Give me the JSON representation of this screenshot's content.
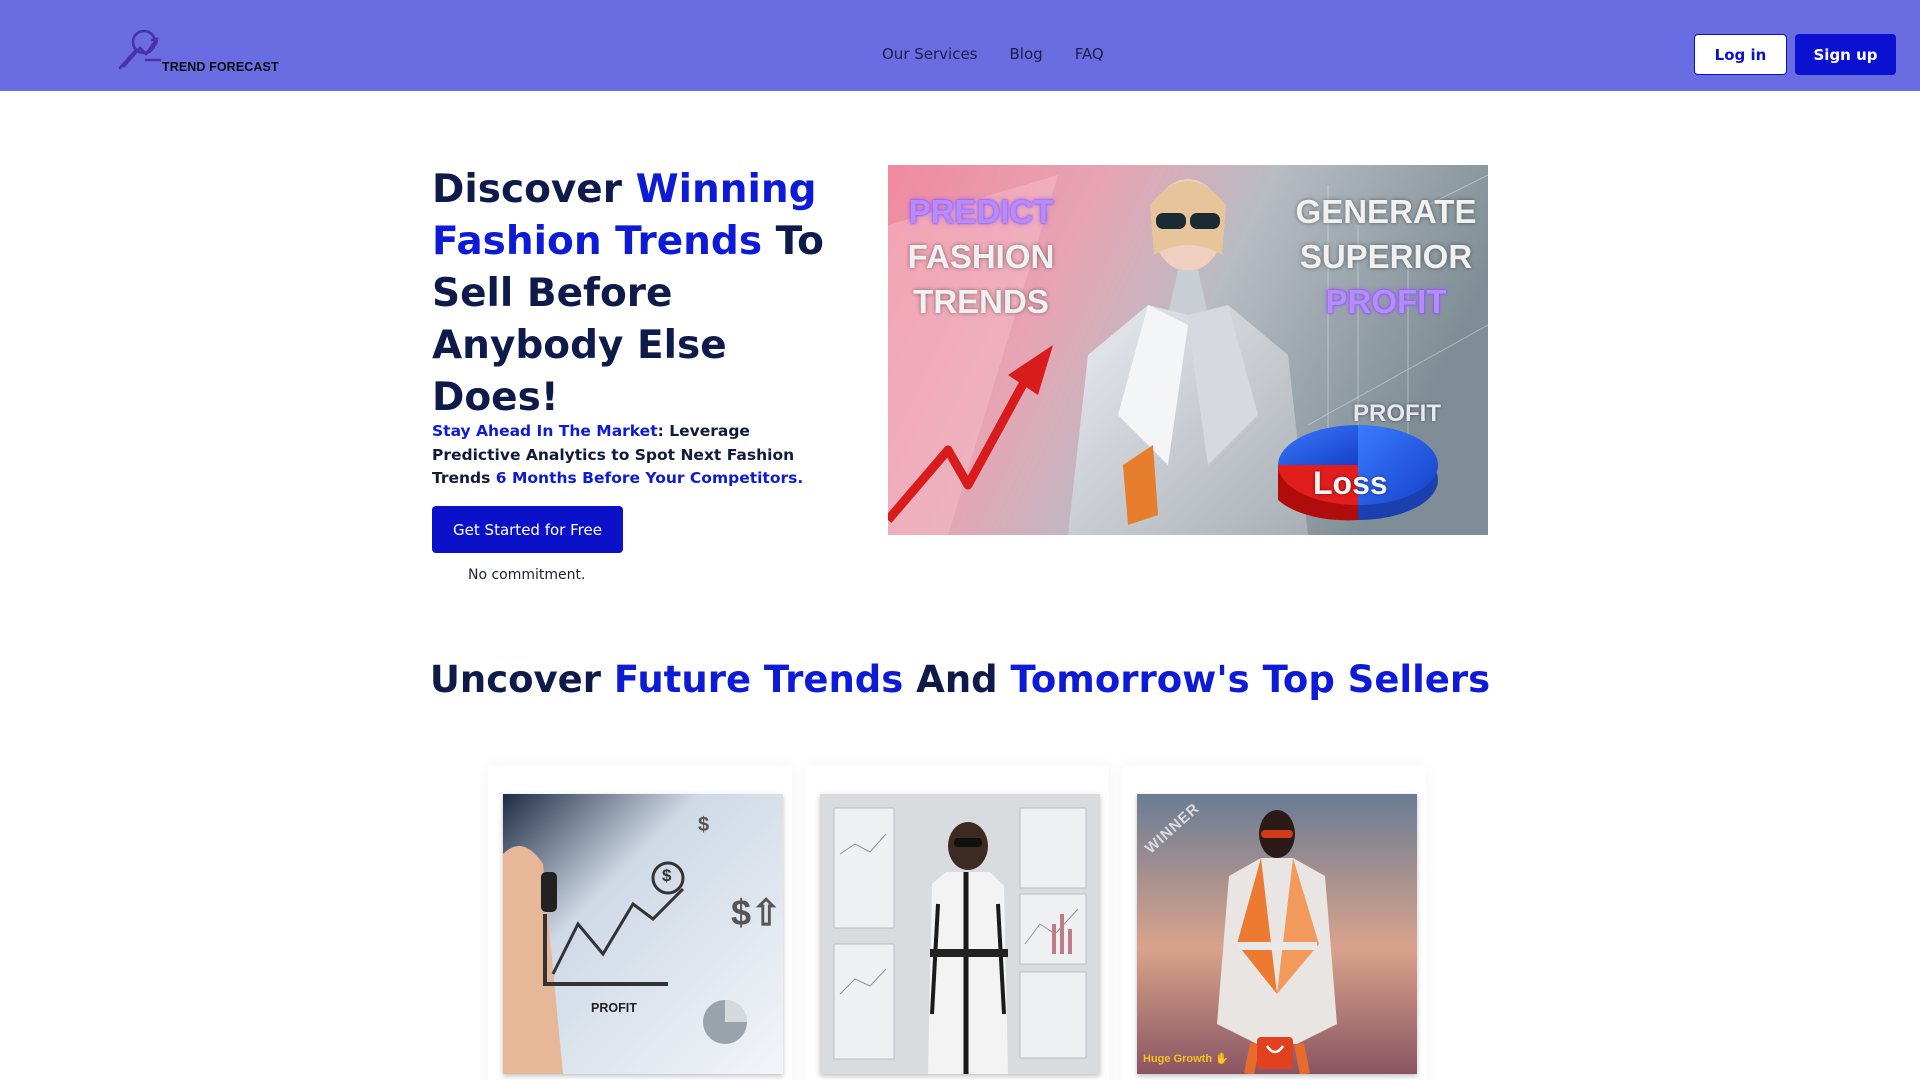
{
  "header": {
    "logo_text": "TREND FORECAST",
    "nav": [
      "Our Services",
      "Blog",
      "FAQ"
    ],
    "login_label": "Log in",
    "signup_label": "Sign up"
  },
  "hero": {
    "title": {
      "part1": "Discover ",
      "highlight": "Winning Fashion Trends",
      "part2": " To Sell Before Anybody Else Does!"
    },
    "subtitle": {
      "highlight1": "Stay Ahead In The Market",
      "text1": ": Leverage Predictive Analytics to Spot Next Fashion Trends ",
      "highlight2": "6 Months Before Your Competitors",
      "text2": "."
    },
    "cta_label": "Get Started for Free",
    "cta_note": "No commitment.",
    "image": {
      "left_line1": "PREDICT",
      "left_line2": "FASHION",
      "left_line3": "TRENDS",
      "right_line1": "GENERATE",
      "right_line2": "SUPERIOR",
      "right_line3": "PROFIT",
      "profit_label": "PROFIT",
      "loss_label": "Loss"
    }
  },
  "section": {
    "title": {
      "part1": "Uncover ",
      "highlight1": "Future Trends",
      "part2": " And ",
      "highlight2": "Tomorrow's Top Sellers"
    },
    "cards": [
      {
        "image_text": "PROFIT",
        "symbol_top": "$",
        "symbol_right": "$⇧",
        "symbol_coin": "$"
      },
      {
        "image_text": ""
      },
      {
        "badge": "WINNER",
        "caption": "Huge Growth ✋"
      }
    ]
  },
  "colors": {
    "nav_bg": "#6a6ce2",
    "accent": "#0d1ad6",
    "primary_button": "#0a11c9",
    "heading": "#0e1a4a"
  }
}
